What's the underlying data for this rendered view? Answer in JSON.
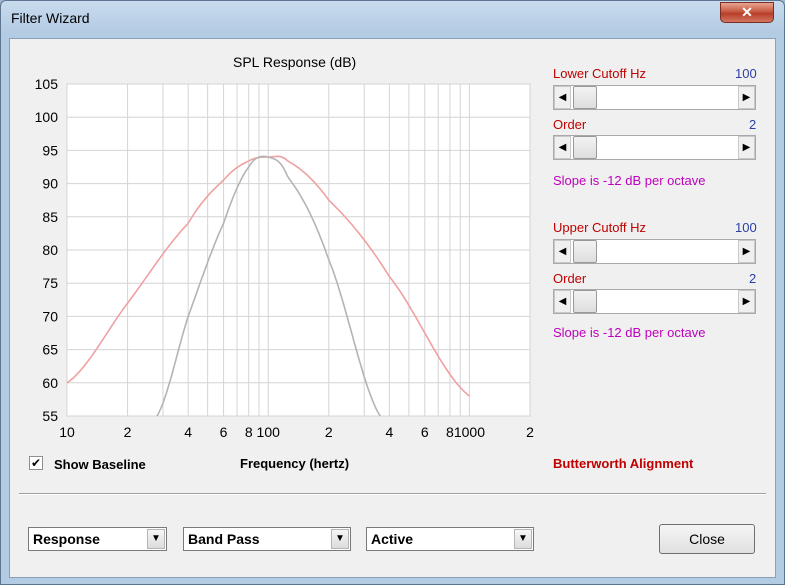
{
  "window": {
    "title": "Filter Wizard",
    "close_glyph": "✕"
  },
  "chart_data": {
    "type": "line",
    "title": "SPL Response (dB)",
    "xlabel": "Frequency (hertz)",
    "ylabel": "",
    "x_scale": "log",
    "xlim": [
      10,
      2000
    ],
    "ylim": [
      55,
      105
    ],
    "y_ticks": [
      "105",
      "100",
      "95",
      "90",
      "85",
      "80",
      "75",
      "70",
      "65",
      "60",
      "55"
    ],
    "x_ticks": [
      "10",
      "2",
      "4",
      "6",
      "8",
      "100",
      "2",
      "4",
      "6",
      "8",
      "1000",
      "2"
    ],
    "series": [
      {
        "color": "#f0a0a0",
        "x": [
          10,
          20,
          40,
          60,
          80,
          100,
          125,
          200,
          400,
          1000
        ],
        "y": [
          60,
          72,
          84,
          90.5,
          93.4,
          94,
          93.4,
          87.5,
          76,
          58
        ]
      },
      {
        "color": "#b4b4b4",
        "x": [
          28,
          40,
          60,
          80,
          100,
          125,
          200,
          360
        ],
        "y": [
          55,
          70,
          84,
          92.5,
          94,
          91,
          78.5,
          55
        ]
      }
    ],
    "grid": true
  },
  "baseline": {
    "label": "Show Baseline",
    "checked_glyph": "✔"
  },
  "lower": {
    "cutoff_label": "Lower Cutoff  Hz",
    "cutoff_value": "100",
    "order_label": "Order",
    "order_value": "2",
    "slope_text": "Slope is -12 dB per octave"
  },
  "upper": {
    "cutoff_label": "Upper Cutoff  Hz",
    "cutoff_value": "100",
    "order_label": "Order",
    "order_value": "2",
    "slope_text": "Slope is -12 dB per octave"
  },
  "alignment_text": "Butterworth Alignment",
  "dropdowns": {
    "view": "Response",
    "filter_type": "Band Pass",
    "mode": "Active"
  },
  "close_label": "Close",
  "colors": {
    "red": "#c00000",
    "blue": "#2b3fa6",
    "magenta": "#c000c0"
  }
}
